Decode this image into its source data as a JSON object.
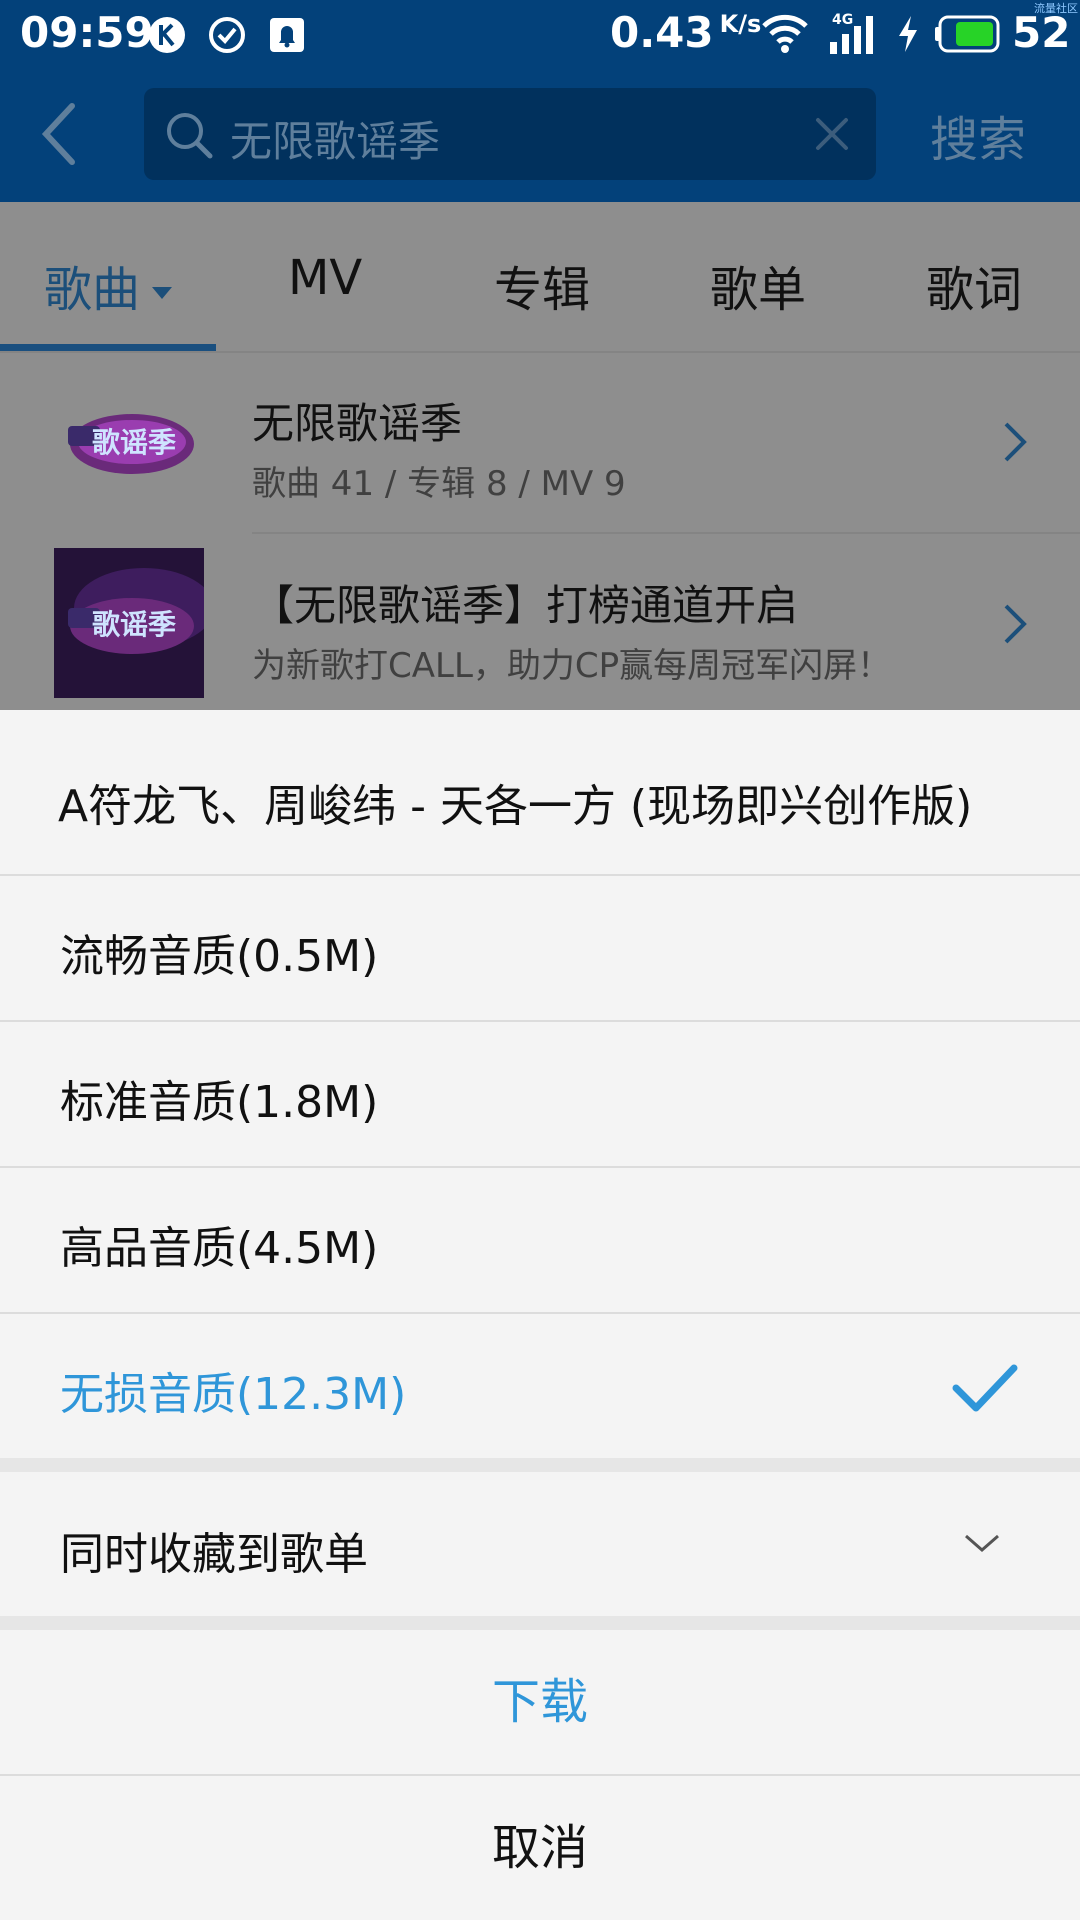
{
  "status_bar": {
    "time": "09:59",
    "speed_value": "0.43",
    "speed_unit": "K/s",
    "network_type": "4G",
    "battery": "52",
    "corner_mark": "流量社区",
    "icons": [
      "k-icon",
      "check-circle-icon",
      "notification-bell-icon",
      "wifi-icon",
      "signal-icon",
      "charging-icon",
      "battery-icon"
    ]
  },
  "header": {
    "search_text": "无限歌谣季",
    "search_button": "搜索"
  },
  "tabs": [
    {
      "label": "歌曲",
      "active": true
    },
    {
      "label": "MV",
      "active": false
    },
    {
      "label": "专辑",
      "active": false
    },
    {
      "label": "歌单",
      "active": false
    },
    {
      "label": "歌词",
      "active": false
    }
  ],
  "results": [
    {
      "title": "无限歌谣季",
      "subtitle": "歌曲 41 / 专辑 8 / MV 9",
      "thumb_text": "歌谣季"
    },
    {
      "title": "【无限歌谣季】打榜通道开启",
      "subtitle": "为新歌打CALL，助力CP赢每周冠军闪屏！",
      "thumb_text": "歌谣季"
    }
  ],
  "sheet": {
    "song_title": "A符龙飞、周峻纬 - 天各一方 (现场即兴创作版)",
    "options": [
      {
        "label": "流畅音质(0.5M)",
        "selected": false
      },
      {
        "label": "标准音质(1.8M)",
        "selected": false
      },
      {
        "label": "高品音质(4.5M)",
        "selected": false
      },
      {
        "label": "无损音质(12.3M)",
        "selected": true
      }
    ],
    "add_to_playlist": "同时收藏到歌单",
    "download": "下载",
    "cancel": "取消"
  },
  "colors": {
    "header_bg": "#03417a",
    "accent": "#2f96d9",
    "overlay_dim": "#8e8e8e"
  }
}
